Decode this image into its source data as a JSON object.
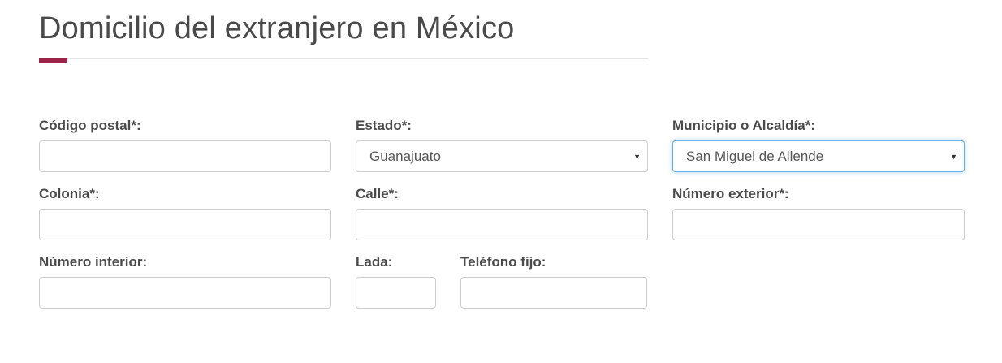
{
  "section": {
    "title": "Domicilio del extranjero en México"
  },
  "fields": {
    "codigo_postal": {
      "label": "Código postal*:",
      "value": ""
    },
    "estado": {
      "label": "Estado*:",
      "value": "Guanajuato"
    },
    "municipio": {
      "label": "Municipio o Alcaldía*:",
      "value": "San Miguel de Allende"
    },
    "colonia": {
      "label": "Colonia*:",
      "value": ""
    },
    "calle": {
      "label": "Calle*:",
      "value": ""
    },
    "numero_exterior": {
      "label": "Número exterior*:",
      "value": ""
    },
    "numero_interior": {
      "label": "Número interior:",
      "value": ""
    },
    "lada": {
      "label": "Lada:",
      "value": ""
    },
    "telefono_fijo": {
      "label": "Teléfono fijo:",
      "value": ""
    }
  },
  "icons": {
    "select_caret": "chevron-down-icon"
  },
  "colors": {
    "accent": "#9d2449",
    "focus_border": "#66afe9",
    "input_border": "#cccccc",
    "heading_text": "#4a4a4a"
  }
}
